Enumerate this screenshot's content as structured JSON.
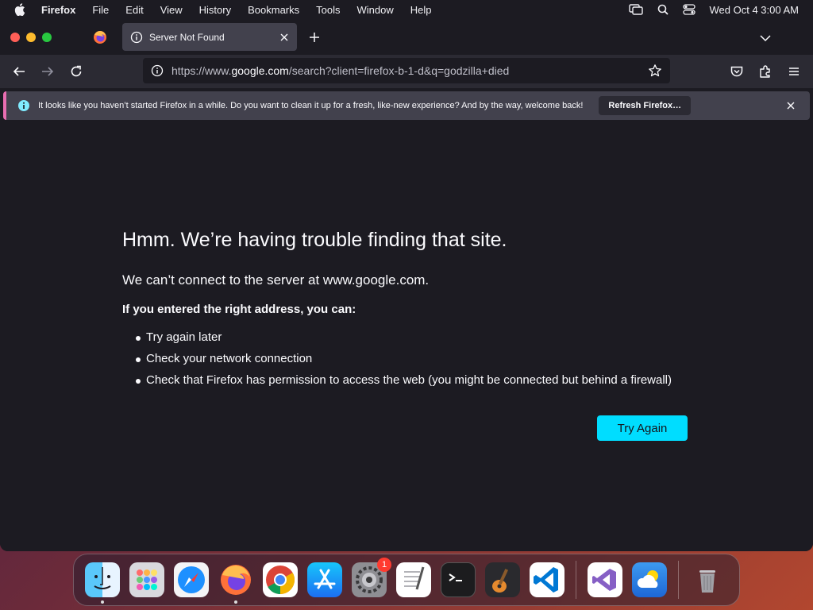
{
  "menubar": {
    "items": [
      "Firefox",
      "File",
      "Edit",
      "View",
      "History",
      "Bookmarks",
      "Tools",
      "Window",
      "Help"
    ],
    "clock": "Wed Oct 4  3:00 AM"
  },
  "tab": {
    "title": "Server Not Found"
  },
  "urlbar": {
    "url_prefix": "https://www.",
    "url_host": "google.com",
    "url_rest": "/search?client=firefox-b-1-d&q=godzilla+died"
  },
  "notice": {
    "text": "It looks like you haven’t started Firefox in a while. Do you want to clean it up for a fresh, like-new experience? And by the way, welcome back!",
    "button": "Refresh Firefox…"
  },
  "error": {
    "title": "Hmm. We’re having trouble finding that site.",
    "description": "We can’t connect to the server at www.google.com.",
    "subtitle": "If you entered the right address, you can:",
    "suggestions": [
      "Try again later",
      "Check your network connection",
      "Check that Firefox has permission to access the web (you might be connected but behind a firewall)"
    ],
    "button": "Try Again"
  },
  "dock": {
    "apps": [
      "Finder",
      "Launchpad",
      "Safari",
      "Firefox",
      "Chrome",
      "App Store",
      "System Settings",
      "TextEdit",
      "Terminal",
      "GarageBand",
      "Visual Studio Code",
      "Visual Studio",
      "Weather",
      "Trash"
    ],
    "settings_badge": "1"
  },
  "colors": {
    "accent_button": "#00ddff",
    "notice_stripe": "#e96eb1",
    "page_background": "#1c1b22"
  }
}
